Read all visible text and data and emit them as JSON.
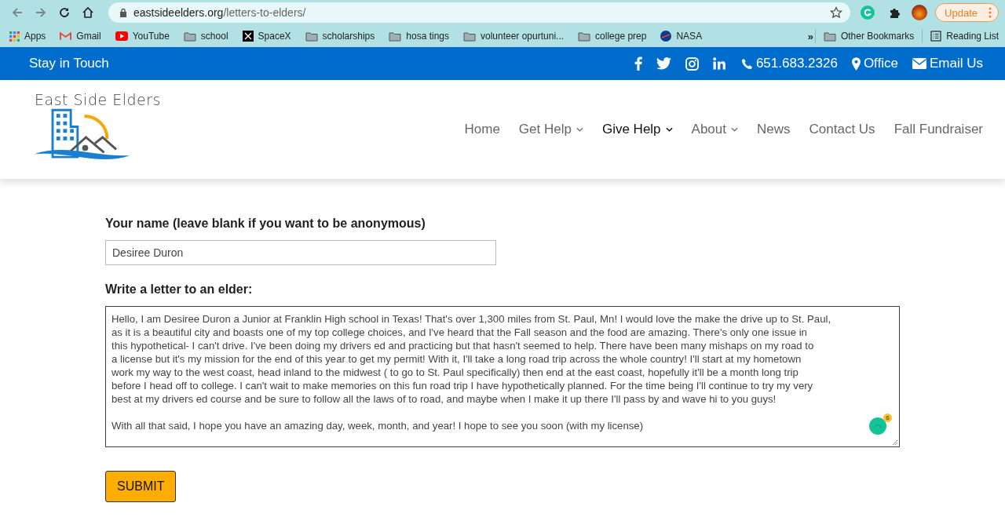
{
  "browser": {
    "url_domain": "eastsideelders.org",
    "url_path": "/letters-to-elders/",
    "update_label": "Update",
    "bookmarks": [
      {
        "kind": "apps",
        "label": "Apps"
      },
      {
        "kind": "gmail",
        "label": "Gmail"
      },
      {
        "kind": "youtube",
        "label": "YouTube"
      },
      {
        "kind": "folder",
        "label": "school"
      },
      {
        "kind": "spacex",
        "label": "SpaceX"
      },
      {
        "kind": "folder",
        "label": "scholarships"
      },
      {
        "kind": "folder",
        "label": "hosa tings"
      },
      {
        "kind": "folder",
        "label": "volunteer opurtuni..."
      },
      {
        "kind": "folder",
        "label": "college prep"
      },
      {
        "kind": "nasa",
        "label": "NASA"
      }
    ],
    "more_label": "»",
    "other_bookmarks": "Other Bookmarks",
    "reading_list": "Reading List"
  },
  "top_bar": {
    "title": "Stay in Touch",
    "social": [
      {
        "kind": "facebook"
      },
      {
        "kind": "twitter"
      },
      {
        "kind": "instagram"
      },
      {
        "kind": "linkedin"
      }
    ],
    "contacts": [
      {
        "kind": "phone",
        "label": "651.683.2326"
      },
      {
        "kind": "location",
        "label": "Office"
      },
      {
        "kind": "email",
        "label": "Email Us"
      }
    ]
  },
  "header": {
    "logo_text": "East Side Elders",
    "nav": [
      {
        "label": "Home",
        "selected": false,
        "dropdown": false
      },
      {
        "label": "Get Help",
        "selected": false,
        "dropdown": true
      },
      {
        "label": "Give Help",
        "selected": true,
        "dropdown": true
      },
      {
        "label": "About",
        "selected": false,
        "dropdown": true
      },
      {
        "label": "News",
        "selected": false,
        "dropdown": false
      },
      {
        "label": "Contact Us",
        "selected": false,
        "dropdown": false
      },
      {
        "label": "Fall Fundraiser",
        "selected": false,
        "dropdown": false
      }
    ]
  },
  "form": {
    "name_label": "Your name (leave blank if you want to be anonymous)",
    "name_value": "Desiree Duron",
    "letter_label": "Write a letter to an elder:",
    "letter_paragraphs": [
      [
        "Hello, I am Desiree Duron a Junior at Franklin High school in Texas! That's over 1,300 miles from St. Paul, Mn! I would love the make the drive up to St. Paul,",
        "as it is a beautiful city and boasts one of my top college choices, and I've heard that the Fall season and the food are amazing. There's only one issue in",
        "this hypothetical- I can't drive. I've been doing my drivers ed and practicing but that hasn't seemed to help. There have been many mishaps on my road to",
        "a license but it's my mission for the end of this year to get my permit! With it, I'll take a long road trip across the whole country! I'll start at my hometown",
        "work my way to the west coast, head inland to the midwest ( to go to St. Paul specifically) then end at the east coast, hopefully it'll be a month long trip",
        "before I head off to college.  I can't wait to make memories on this fun road trip I have hypothetically planned. For the time being I'll continue to try my very",
        "best at my drivers ed course and be sure to follow all the laws of to road, and maybe when I make it up there I'll pass by and wave hi to you guys!"
      ],
      [
        "With all that said, I hope you have an amazing day, week, month, and year! I hope to see you soon (with my license)"
      ]
    ],
    "grammarly_count": "6",
    "submit": "SUBMIT"
  }
}
